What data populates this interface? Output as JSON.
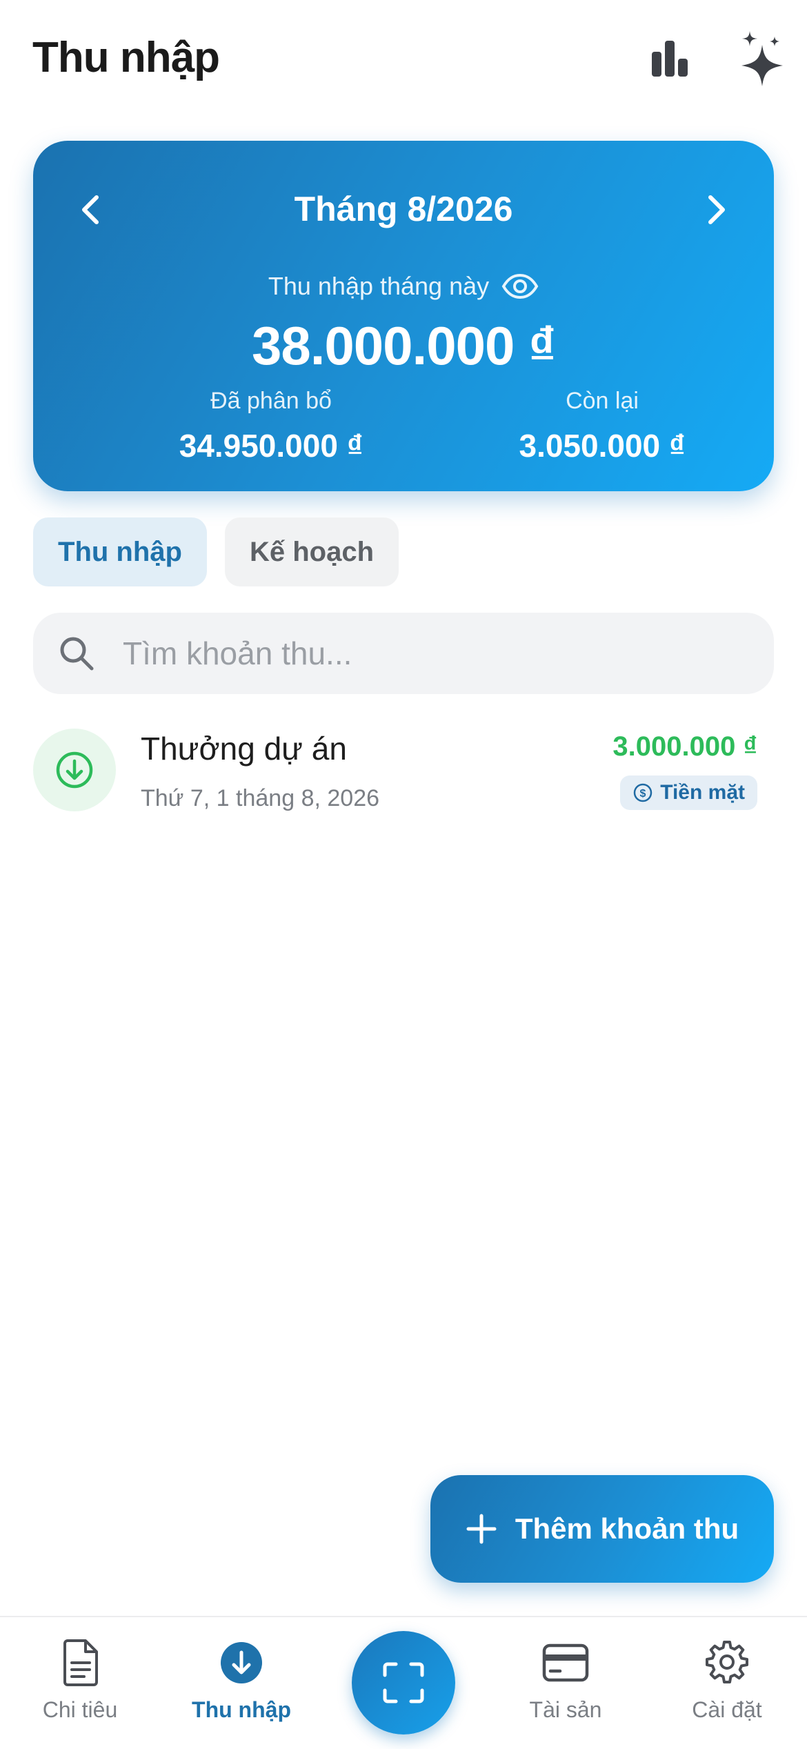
{
  "header": {
    "title": "Thu nhập",
    "chart_icon": "bar-chart-icon",
    "ai_icon": "sparkles-icon"
  },
  "summary": {
    "month_label": "Tháng 8/2026",
    "income_label": "Thu nhập tháng này",
    "income_amount": "38.000.000 ₫",
    "allocated_label": "Đã phân bổ",
    "allocated_amount": "34.950.000 ₫",
    "remaining_label": "Còn lại",
    "remaining_amount": "3.050.000 ₫"
  },
  "tabs": [
    {
      "label": "Thu nhập",
      "active": true
    },
    {
      "label": "Kế hoạch",
      "active": false
    }
  ],
  "search": {
    "placeholder": "Tìm khoản thu...",
    "value": ""
  },
  "items": [
    {
      "name": "Thưởng dự án",
      "date": "Thứ 7, 1 tháng 8, 2026",
      "amount": "3.000.000 ₫",
      "method": "Tiền mặt",
      "icon": "arrow-down-circle-icon"
    }
  ],
  "fab": {
    "label": "Thêm khoản thu"
  },
  "nav": [
    {
      "label": "Chi tiêu",
      "icon": "document-icon",
      "active": false
    },
    {
      "label": "Thu nhập",
      "icon": "arrow-down-circle-icon",
      "active": true
    },
    {
      "label": "",
      "icon": "scan-icon",
      "active": false
    },
    {
      "label": "Tài sản",
      "icon": "credit-card-icon",
      "active": false
    },
    {
      "label": "Cài đặt",
      "icon": "gear-icon",
      "active": false
    }
  ],
  "colors": {
    "accent": "#1f72ab",
    "card_gradient_start": "#1b72b0",
    "card_gradient_end": "#15aaf5",
    "income_green": "#2dbb5a"
  }
}
